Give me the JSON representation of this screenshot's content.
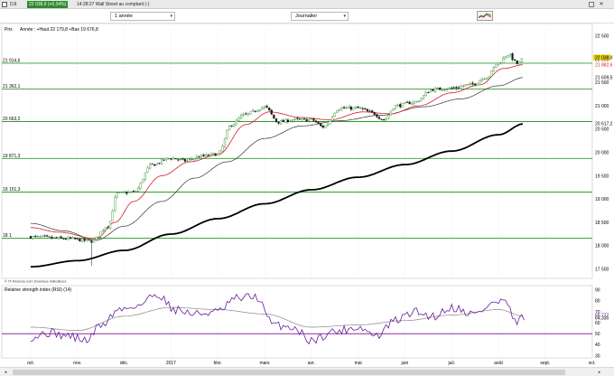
{
  "header": {
    "symbol": "DJI",
    "price_badge": "22 038,9 (+0,34%)",
    "time_label": "14:28:27 Wall Street au comptant (-)"
  },
  "toolbar": {
    "period": "1 année",
    "interval": "Journalier"
  },
  "price_panel": {
    "prefix": "Prix",
    "info": "Année : +Haut 22 179,8 +Bas 19 676,8",
    "source": "© IT-Finance.com  Données indicatives"
  },
  "colors": {
    "bg": "#ffffff",
    "candle_up": "#2e8b2e",
    "candle_down": "#1a1a1a",
    "sma_short": "#d21f2a",
    "sma_medium": "#333333",
    "sma_long": "#000000",
    "level": "#2e9e2e",
    "rsi": "#6a1b9a",
    "rsi_signal": "#888888",
    "rsi_level": "#8b2fa0",
    "badge": "#2e8b2e"
  },
  "chart_data": [
    {
      "type": "line",
      "title": "",
      "y_ticks": [
        "22 500",
        "22 000",
        "21 500",
        "21 000",
        "20 500",
        "20 000",
        "19 500",
        "19 000",
        "18 500",
        "18 000",
        "17 500"
      ],
      "x_ticks": [
        "oct.",
        "nov.",
        "déc.",
        "2017",
        "févr.",
        "mars",
        "avr.",
        "mai",
        "juin",
        "juil.",
        "août",
        "sept.",
        "oct."
      ],
      "ylim": [
        17300,
        22650
      ],
      "levels": [
        {
          "value": 21914.6,
          "label": "21 914,6"
        },
        {
          "value": 21362.1,
          "label": "21 362,1"
        },
        {
          "value": 20663.2,
          "label": "20 663,2"
        },
        {
          "value": 19871.3,
          "label": "19 871,3"
        },
        {
          "value": 19151.3,
          "label": "19 151,3"
        }
      ],
      "right_labels": [
        {
          "value": 22038.9,
          "label": "22 038,9",
          "color": "#e8d000"
        },
        {
          "value": 21882.6,
          "label": "21 882,6",
          "color": "#d21f2a"
        },
        {
          "value": 21609.5,
          "label": "21 609,5",
          "color": "#000000"
        },
        {
          "value": 20617.2,
          "label": "20 617,2",
          "color": "#000000"
        }
      ],
      "left_labels": [
        {
          "value": 18160,
          "label": "18 1"
        }
      ],
      "anchors": [
        {
          "m": 0.0,
          "v": 18190
        },
        {
          "m": 0.8,
          "v": 18150
        },
        {
          "m": 1.3,
          "v": 18100
        },
        {
          "m": 1.65,
          "v": 18420
        },
        {
          "m": 1.85,
          "v": 19120
        },
        {
          "m": 2.2,
          "v": 19150
        },
        {
          "m": 2.6,
          "v": 19740
        },
        {
          "m": 3.0,
          "v": 19880
        },
        {
          "m": 3.3,
          "v": 19820
        },
        {
          "m": 3.65,
          "v": 19920
        },
        {
          "m": 4.0,
          "v": 19970
        },
        {
          "m": 4.3,
          "v": 20600
        },
        {
          "m": 4.55,
          "v": 20800
        },
        {
          "m": 5.0,
          "v": 20970
        },
        {
          "m": 5.3,
          "v": 20650
        },
        {
          "m": 5.6,
          "v": 20700
        },
        {
          "m": 6.0,
          "v": 20700
        },
        {
          "m": 6.25,
          "v": 20550
        },
        {
          "m": 6.6,
          "v": 20950
        },
        {
          "m": 7.0,
          "v": 20950
        },
        {
          "m": 7.3,
          "v": 20850
        },
        {
          "m": 7.55,
          "v": 20700
        },
        {
          "m": 7.8,
          "v": 21000
        },
        {
          "m": 8.2,
          "v": 21080
        },
        {
          "m": 8.6,
          "v": 21350
        },
        {
          "m": 9.0,
          "v": 21380
        },
        {
          "m": 9.4,
          "v": 21450
        },
        {
          "m": 9.75,
          "v": 21620
        },
        {
          "m": 10.0,
          "v": 21920
        },
        {
          "m": 10.2,
          "v": 22100
        },
        {
          "m": 10.42,
          "v": 21900
        },
        {
          "m": 10.55,
          "v": 22039
        }
      ],
      "sma_short_anchors": [
        {
          "m": 0.0,
          "v": 18390
        },
        {
          "m": 0.6,
          "v": 18290
        },
        {
          "m": 1.4,
          "v": 18150
        },
        {
          "m": 1.8,
          "v": 18500
        },
        {
          "m": 2.2,
          "v": 18950
        },
        {
          "m": 2.8,
          "v": 19500
        },
        {
          "m": 3.4,
          "v": 19800
        },
        {
          "m": 4.0,
          "v": 19950
        },
        {
          "m": 4.6,
          "v": 20600
        },
        {
          "m": 5.1,
          "v": 20870
        },
        {
          "m": 5.8,
          "v": 20750
        },
        {
          "m": 6.4,
          "v": 20700
        },
        {
          "m": 7.1,
          "v": 20870
        },
        {
          "m": 7.7,
          "v": 20830
        },
        {
          "m": 8.3,
          "v": 21000
        },
        {
          "m": 9.0,
          "v": 21280
        },
        {
          "m": 9.6,
          "v": 21450
        },
        {
          "m": 10.1,
          "v": 21800
        },
        {
          "m": 10.55,
          "v": 21883
        }
      ],
      "sma_medium_anchors": [
        {
          "m": 0.0,
          "v": 18480
        },
        {
          "m": 0.7,
          "v": 18320
        },
        {
          "m": 1.4,
          "v": 18120
        },
        {
          "m": 2.0,
          "v": 18420
        },
        {
          "m": 2.8,
          "v": 18950
        },
        {
          "m": 3.5,
          "v": 19450
        },
        {
          "m": 4.2,
          "v": 19800
        },
        {
          "m": 5.0,
          "v": 20300
        },
        {
          "m": 5.8,
          "v": 20570
        },
        {
          "m": 6.6,
          "v": 20680
        },
        {
          "m": 7.5,
          "v": 20800
        },
        {
          "m": 8.4,
          "v": 20980
        },
        {
          "m": 9.2,
          "v": 21150
        },
        {
          "m": 10.0,
          "v": 21430
        },
        {
          "m": 10.55,
          "v": 21610
        }
      ],
      "sma_long_anchors": [
        {
          "m": 0.0,
          "v": 17550
        },
        {
          "m": 1.0,
          "v": 17680
        },
        {
          "m": 2.0,
          "v": 17900
        },
        {
          "m": 3.0,
          "v": 18250
        },
        {
          "m": 4.0,
          "v": 18580
        },
        {
          "m": 5.0,
          "v": 18900
        },
        {
          "m": 6.0,
          "v": 19200
        },
        {
          "m": 7.0,
          "v": 19470
        },
        {
          "m": 8.0,
          "v": 19740
        },
        {
          "m": 9.0,
          "v": 20030
        },
        {
          "m": 10.0,
          "v": 20380
        },
        {
          "m": 10.55,
          "v": 20617
        }
      ]
    },
    {
      "type": "line",
      "title": "Relative strength index (RSI) (14)",
      "y_ticks": [
        "90",
        "80",
        "70",
        "60",
        "50",
        "40",
        "30"
      ],
      "ylim": [
        28,
        93
      ],
      "levels": [
        {
          "value": 50
        }
      ],
      "right_labels": [
        {
          "value": 66.777,
          "label": "66,777",
          "color": "#6a1b9a"
        },
        {
          "value": 64.33,
          "label": "64,330",
          "color": "#000000"
        }
      ],
      "rsi_anchors": [
        {
          "m": 0.0,
          "v": 47
        },
        {
          "m": 0.4,
          "v": 51
        },
        {
          "m": 0.8,
          "v": 48
        },
        {
          "m": 1.2,
          "v": 44
        },
        {
          "m": 1.5,
          "v": 58
        },
        {
          "m": 1.9,
          "v": 72
        },
        {
          "m": 2.3,
          "v": 76
        },
        {
          "m": 2.7,
          "v": 86
        },
        {
          "m": 3.1,
          "v": 72
        },
        {
          "m": 3.5,
          "v": 68
        },
        {
          "m": 4.0,
          "v": 70
        },
        {
          "m": 4.4,
          "v": 82
        },
        {
          "m": 4.8,
          "v": 84
        },
        {
          "m": 5.2,
          "v": 58
        },
        {
          "m": 5.6,
          "v": 56
        },
        {
          "m": 6.0,
          "v": 44
        },
        {
          "m": 6.5,
          "v": 52
        },
        {
          "m": 7.0,
          "v": 56
        },
        {
          "m": 7.4,
          "v": 48
        },
        {
          "m": 7.8,
          "v": 62
        },
        {
          "m": 8.2,
          "v": 70
        },
        {
          "m": 8.6,
          "v": 66
        },
        {
          "m": 9.0,
          "v": 74
        },
        {
          "m": 9.5,
          "v": 68
        },
        {
          "m": 9.9,
          "v": 78
        },
        {
          "m": 10.15,
          "v": 80
        },
        {
          "m": 10.35,
          "v": 60
        },
        {
          "m": 10.55,
          "v": 65
        }
      ],
      "signal_anchors": [
        {
          "m": 0.0,
          "v": 56
        },
        {
          "m": 1.0,
          "v": 53
        },
        {
          "m": 2.0,
          "v": 66
        },
        {
          "m": 3.0,
          "v": 74
        },
        {
          "m": 4.0,
          "v": 72
        },
        {
          "m": 5.0,
          "v": 68
        },
        {
          "m": 6.0,
          "v": 56
        },
        {
          "m": 7.0,
          "v": 58
        },
        {
          "m": 8.0,
          "v": 62
        },
        {
          "m": 9.0,
          "v": 67
        },
        {
          "m": 10.0,
          "v": 72
        },
        {
          "m": 10.55,
          "v": 66
        }
      ]
    }
  ]
}
